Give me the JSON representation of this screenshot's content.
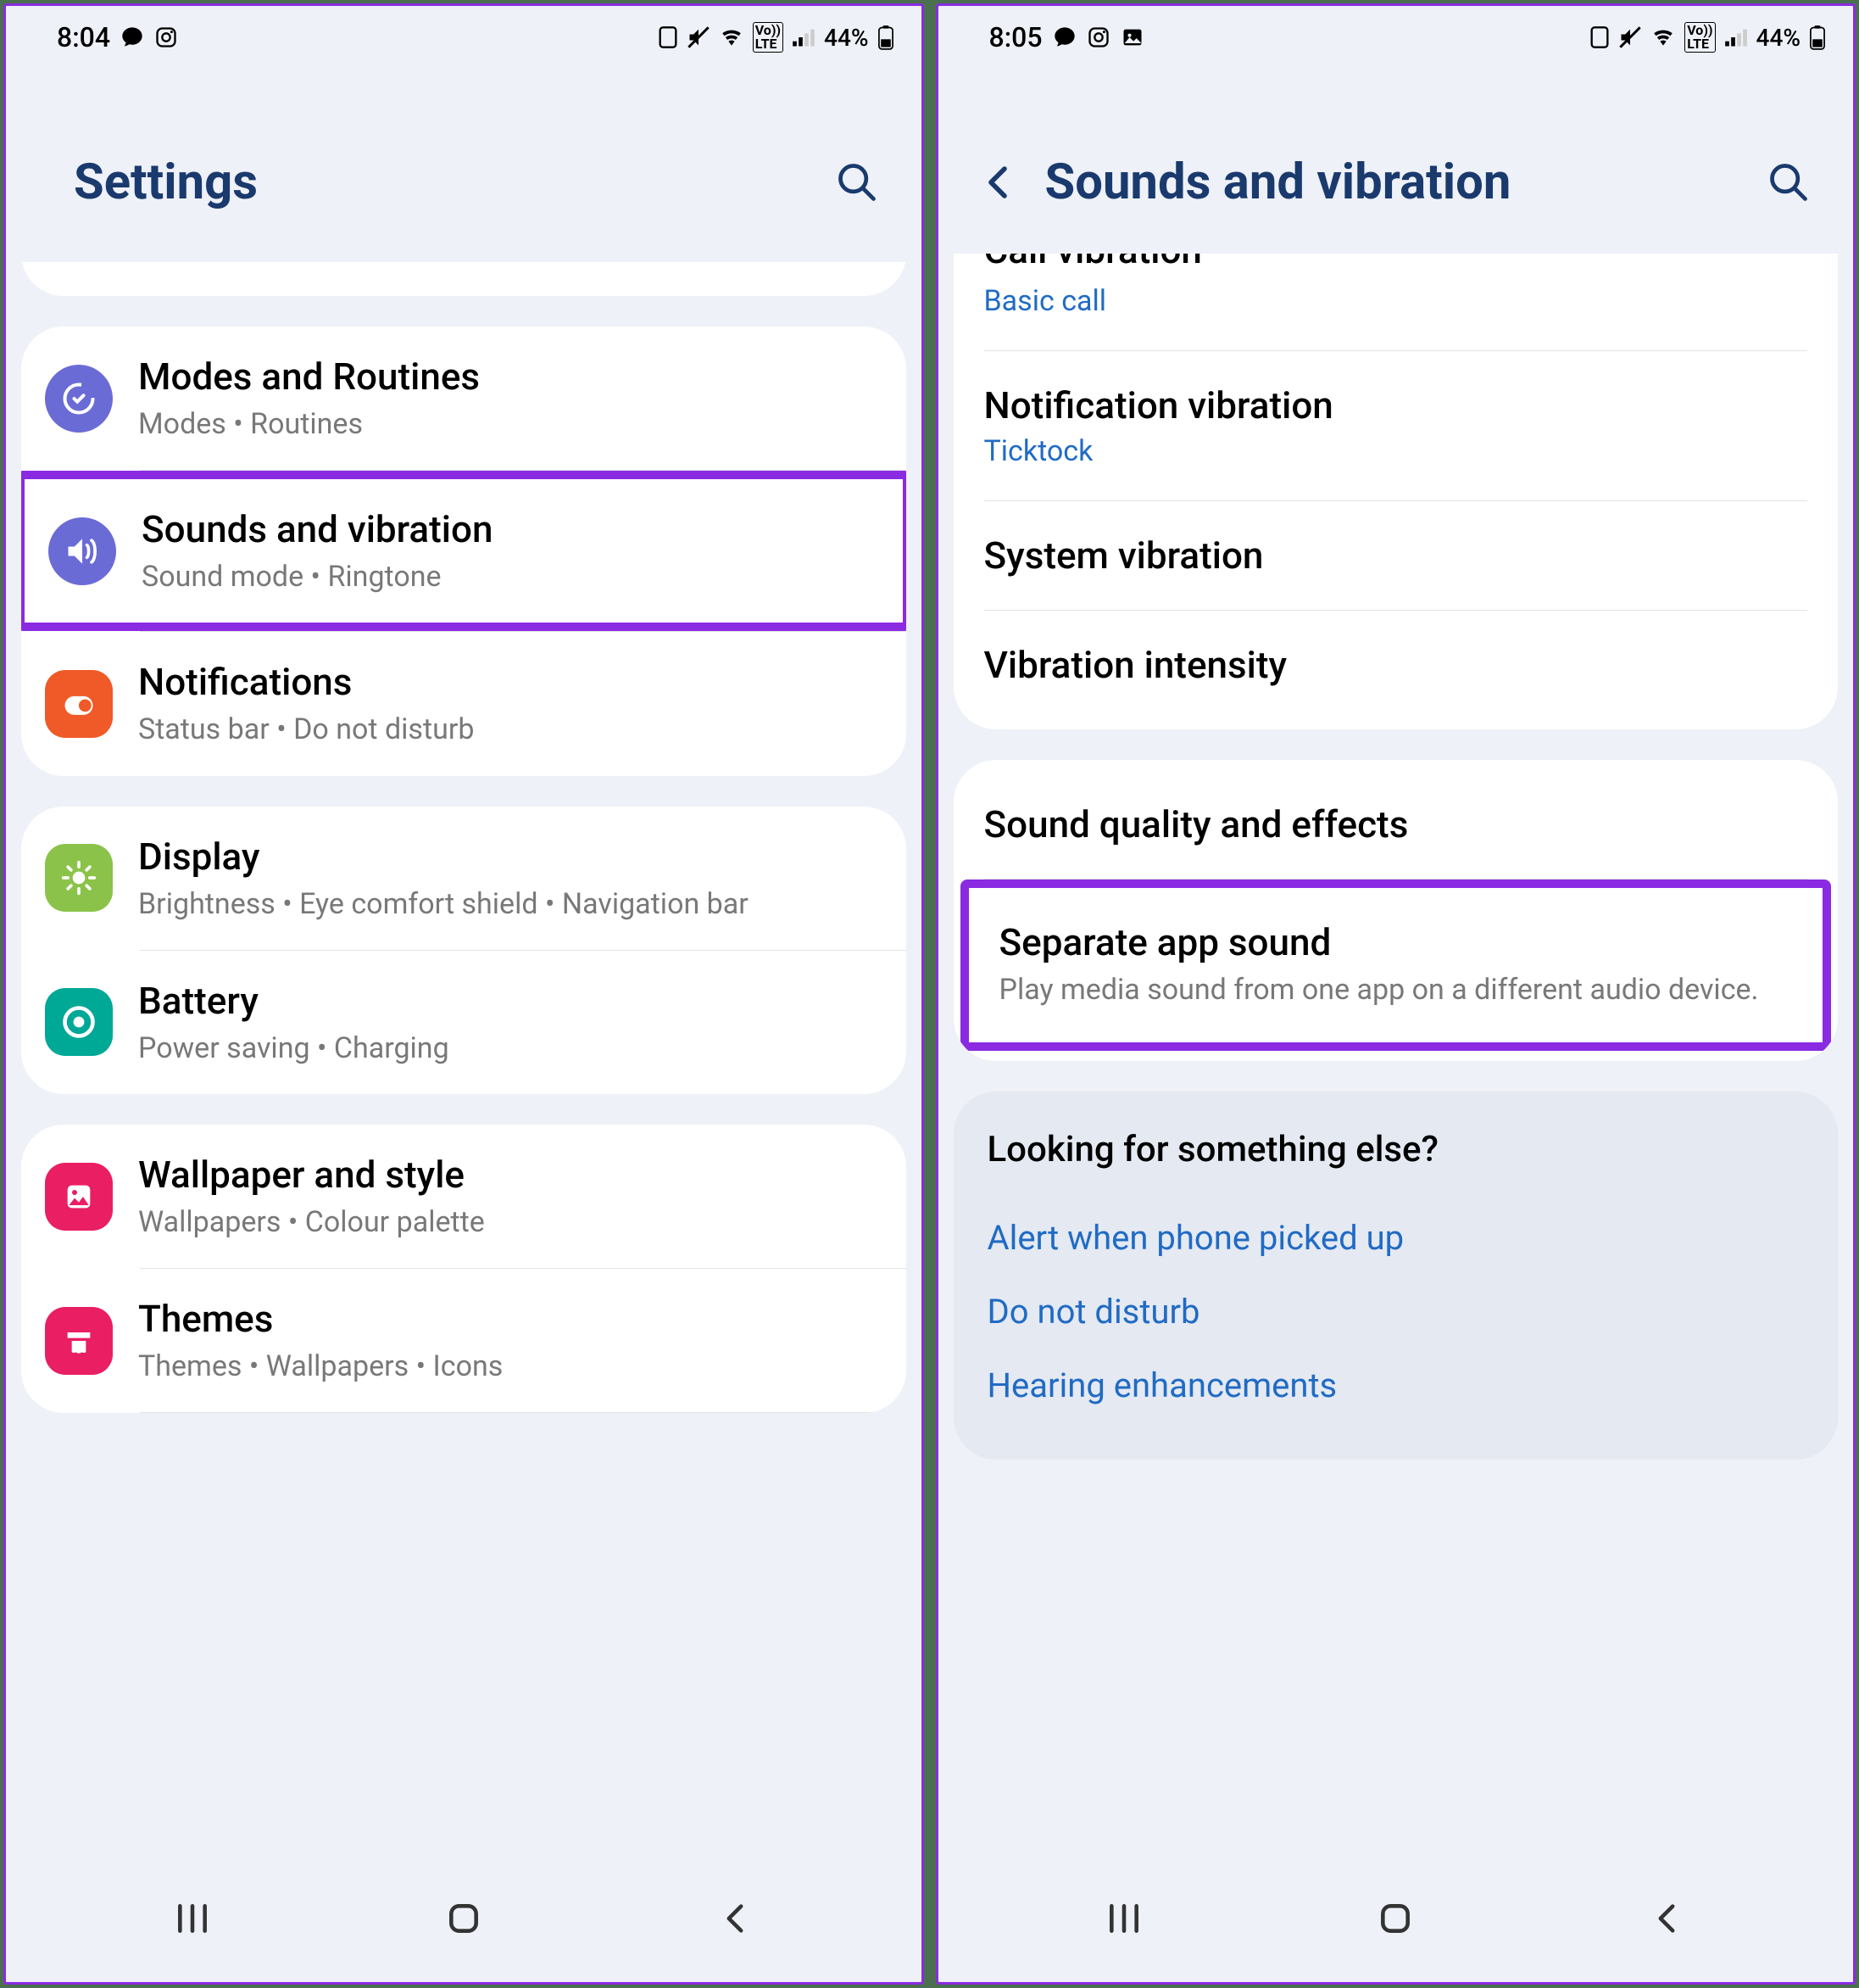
{
  "left": {
    "status": {
      "time": "8:04",
      "battery": "44%"
    },
    "title": "Settings",
    "groups": [
      {
        "partial": true,
        "items": []
      },
      {
        "items": [
          {
            "title": "Modes and Routines",
            "sub": "Modes  •  Routines",
            "iconColor": "#6b6bd6",
            "iconName": "routines-icon"
          },
          {
            "title": "Sounds and vibration",
            "sub": "Sound mode  •  Ringtone",
            "iconColor": "#6b6bd6",
            "iconName": "sound-icon",
            "highlight": true
          },
          {
            "title": "Notifications",
            "sub": "Status bar  •  Do not disturb",
            "iconColor": "#f05a28",
            "iconName": "notifications-icon"
          }
        ]
      },
      {
        "items": [
          {
            "title": "Display",
            "sub": "Brightness  •  Eye comfort shield  •  Navigation bar",
            "iconColor": "#8bc34a",
            "iconName": "display-icon"
          },
          {
            "title": "Battery",
            "sub": "Power saving  •  Charging",
            "iconColor": "#00a896",
            "iconName": "battery-icon"
          }
        ]
      },
      {
        "items": [
          {
            "title": "Wallpaper and style",
            "sub": "Wallpapers  •  Colour palette",
            "iconColor": "#e91e63",
            "iconName": "wallpaper-icon"
          },
          {
            "title": "Themes",
            "sub": "Themes  •  Wallpapers  •  Icons",
            "iconColor": "#e91e63",
            "iconName": "themes-icon"
          }
        ]
      }
    ]
  },
  "right": {
    "status": {
      "time": "8:05",
      "battery": "44%"
    },
    "title": "Sounds and vibration",
    "partialTop": "Call vibration",
    "group1": [
      {
        "title": "Call vibration",
        "sub": "Basic call",
        "partial": true
      },
      {
        "title": "Notification vibration",
        "sub": "Ticktock"
      },
      {
        "title": "System vibration"
      },
      {
        "title": "Vibration intensity"
      }
    ],
    "group2": [
      {
        "title": "Sound quality and effects"
      },
      {
        "title": "Separate app sound",
        "sub": "Play media sound from one app on a different audio device.",
        "highlight": true,
        "subGray": true
      }
    ],
    "looking": {
      "title": "Looking for something else?",
      "links": [
        "Alert when phone picked up",
        "Do not disturb",
        "Hearing enhancements"
      ]
    }
  }
}
